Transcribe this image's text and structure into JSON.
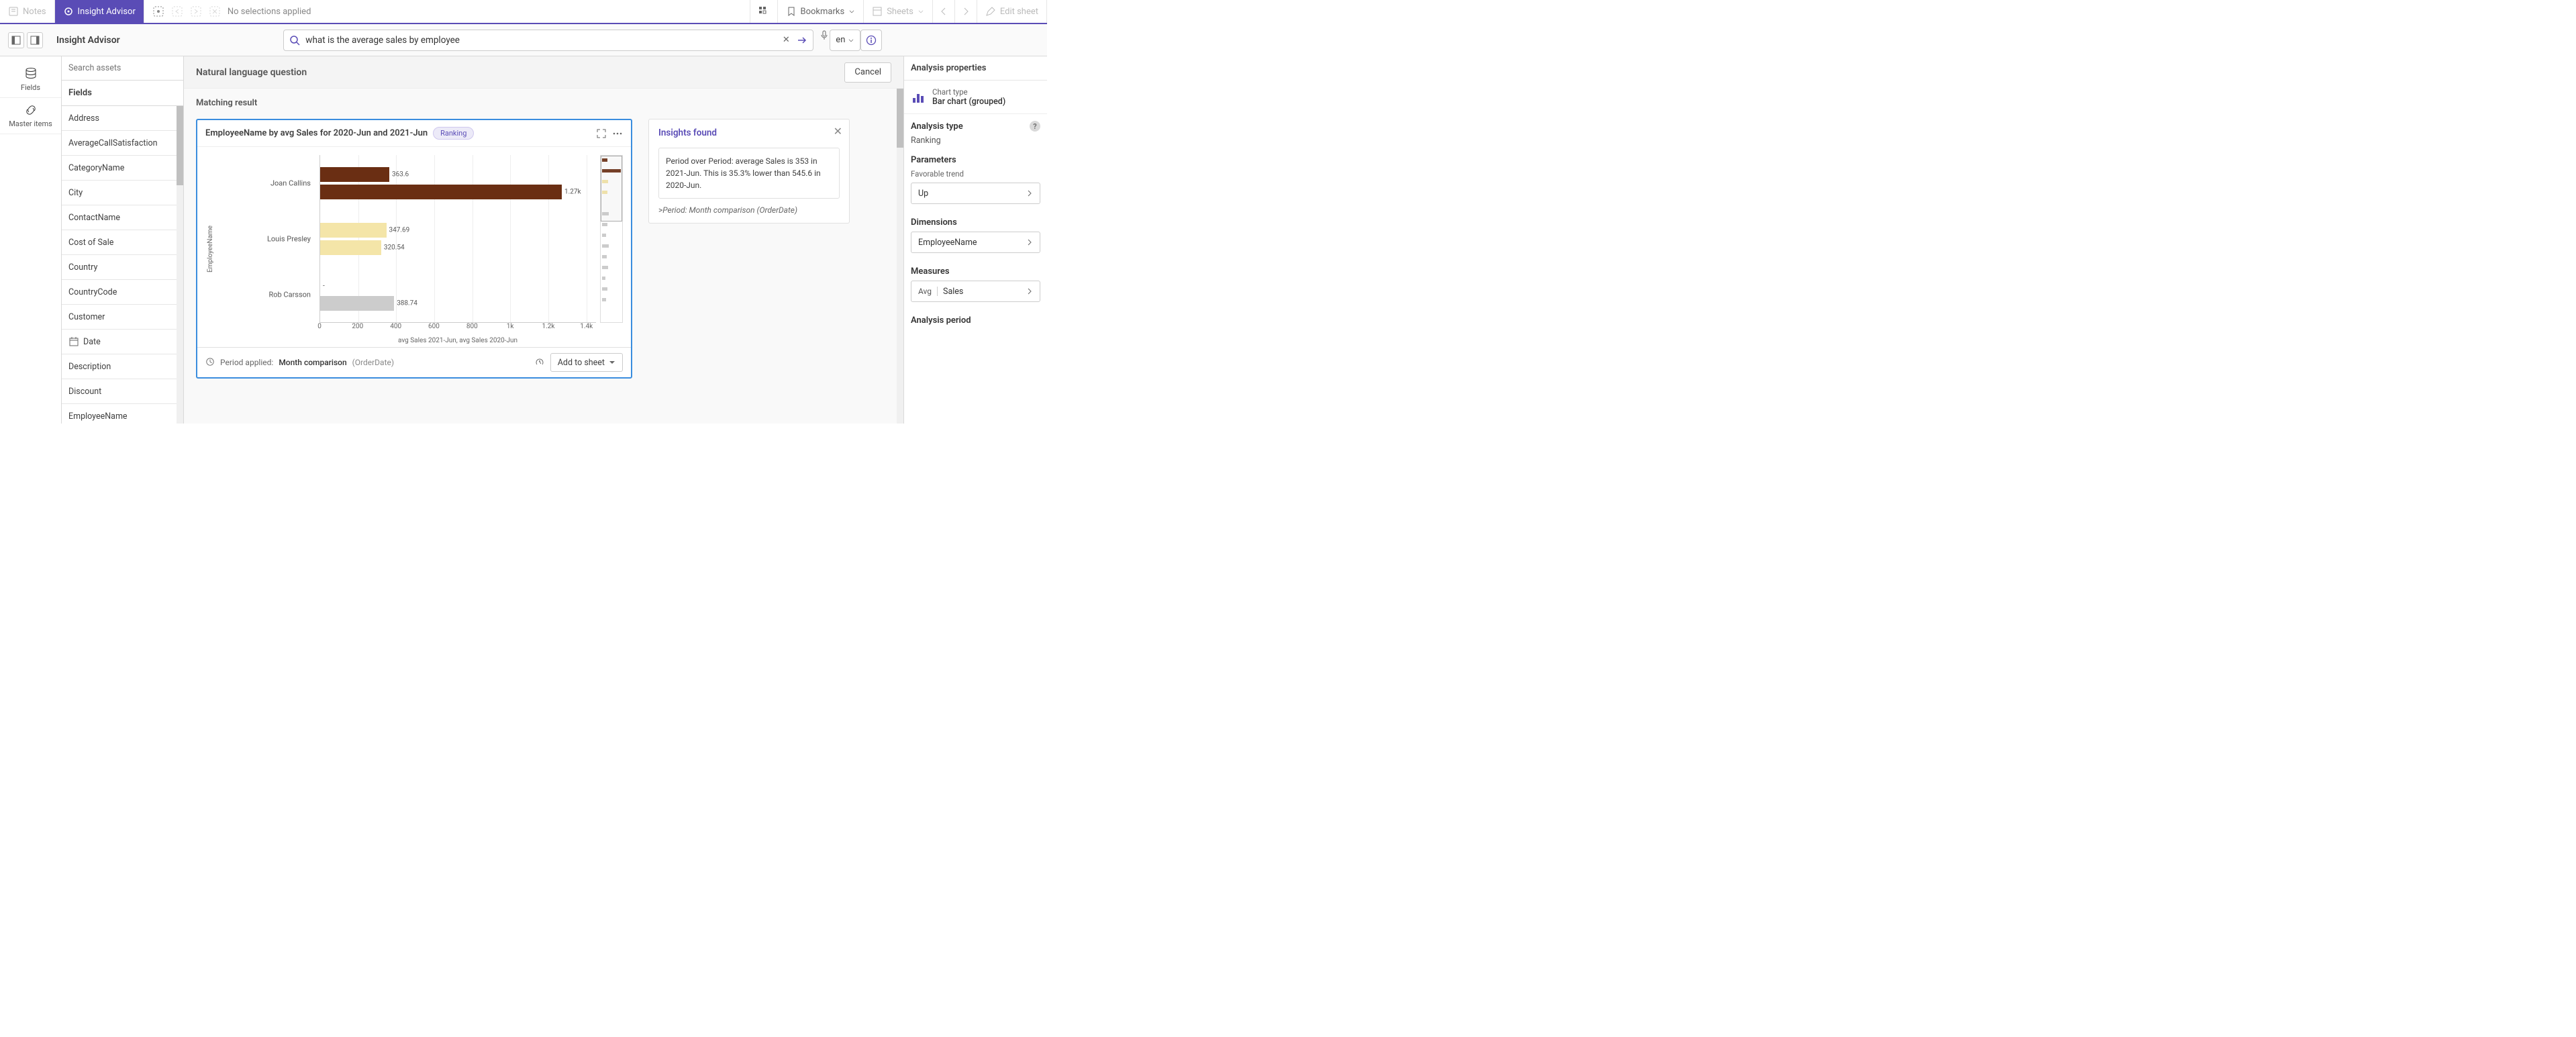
{
  "toolbar": {
    "notes": "Notes",
    "insight_advisor": "Insight Advisor",
    "no_selections": "No selections applied",
    "bookmarks": "Bookmarks",
    "sheets": "Sheets",
    "edit_sheet": "Edit sheet"
  },
  "header": {
    "title": "Insight Advisor",
    "search_value": "what is the average sales by employee",
    "lang": "en"
  },
  "rail": {
    "fields": "Fields",
    "master_items": "Master items"
  },
  "assets": {
    "search_placeholder": "Search assets",
    "section_title": "Fields",
    "items": [
      {
        "label": "Address",
        "icon": null
      },
      {
        "label": "AverageCallSatisfaction",
        "icon": null
      },
      {
        "label": "CategoryName",
        "icon": null
      },
      {
        "label": "City",
        "icon": null
      },
      {
        "label": "ContactName",
        "icon": null
      },
      {
        "label": "Cost of Sale",
        "icon": null
      },
      {
        "label": "Country",
        "icon": null
      },
      {
        "label": "CountryCode",
        "icon": null
      },
      {
        "label": "Customer",
        "icon": null
      },
      {
        "label": "Date",
        "icon": "calendar"
      },
      {
        "label": "Description",
        "icon": null
      },
      {
        "label": "Discount",
        "icon": null
      },
      {
        "label": "EmployeeName",
        "icon": null
      }
    ]
  },
  "center": {
    "nlq_label": "Natural language question",
    "cancel_label": "Cancel",
    "matching_label": "Matching result",
    "chart": {
      "title": "EmployeeName by avg Sales for 2020-Jun and 2021-Jun",
      "badge": "Ranking",
      "ylabel": "EmployeeName",
      "xlabel": "avg Sales 2021-Jun, avg Sales 2020-Jun",
      "period_applied_label": "Period applied:",
      "period_value": "Month comparison",
      "period_source": "(OrderDate)",
      "add_to_sheet": "Add to sheet"
    },
    "insights": {
      "title": "Insights found",
      "body": "Period over Period: average Sales is 353 in 2021-Jun. This is 35.3% lower than 545.6 in 2020-Jun.",
      "sub_prefix": ">",
      "sub_text": "Period: Month comparison (OrderDate)"
    }
  },
  "props": {
    "head": "Analysis properties",
    "chart_type_label": "Chart type",
    "chart_type_value": "Bar chart (grouped)",
    "analysis_type_label": "Analysis type",
    "analysis_type_value": "Ranking",
    "parameters_label": "Parameters",
    "favorable_trend_label": "Favorable trend",
    "favorable_trend_value": "Up",
    "dimensions_label": "Dimensions",
    "dimension_value": "EmployeeName",
    "measures_label": "Measures",
    "measure_agg": "Avg",
    "measure_field": "Sales",
    "period_label": "Analysis period"
  },
  "chart_data": {
    "type": "bar",
    "orientation": "horizontal",
    "grouped": true,
    "xlim": [
      0,
      1450
    ],
    "xticks": [
      0,
      200,
      400,
      600,
      800,
      1000,
      1200,
      1400
    ],
    "xtick_labels": [
      "0",
      "200",
      "400",
      "600",
      "800",
      "1k",
      "1.2k",
      "1.4k"
    ],
    "ylabel": "EmployeeName",
    "xlabel": "avg Sales 2021-Jun, avg Sales 2020-Jun",
    "categories": [
      "Joan Callins",
      "Louis Presley",
      "Rob Carsson"
    ],
    "series": [
      {
        "name": "avg Sales 2021-Jun",
        "values": [
          363.6,
          347.69,
          null
        ],
        "color": "#6a2e13"
      },
      {
        "name": "avg Sales 2020-Jun",
        "values": [
          1270,
          320.54,
          388.74
        ],
        "color_per_cat": [
          "#6a2e13",
          "#f4e5a8",
          "#cccccc"
        ]
      }
    ],
    "value_labels": [
      "363.6",
      "1.27k",
      "347.69",
      "320.54",
      "-",
      "388.74"
    ]
  }
}
